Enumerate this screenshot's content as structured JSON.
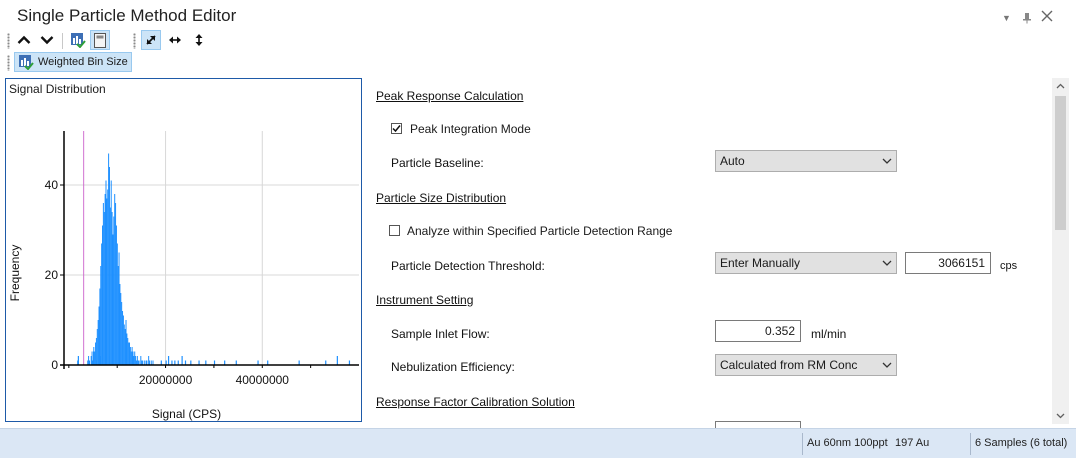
{
  "window": {
    "title": "Single Particle Method Editor",
    "controls": {
      "dropdown": "▼",
      "pin": "📌",
      "close": "✕"
    }
  },
  "toolbar1": {
    "up_icon": "chevron-up-icon",
    "down_icon": "chevron-down-icon",
    "tool3_icon": "chart-check-icon",
    "tool4_icon": "calculator-icon",
    "fit_icon": "diagonal-resize-icon",
    "horizontal_icon": "horizontal-resize-icon",
    "vertical_icon": "vertical-resize-icon"
  },
  "toolbar2": {
    "weighted_bin_label": "Weighted Bin Size"
  },
  "chart_panel": {
    "title": "Signal Distribution"
  },
  "chart_data": {
    "type": "bar",
    "title": "Signal Distribution",
    "xlabel": "Signal (CPS)",
    "ylabel": "Frequency",
    "xlim": [
      -1000000,
      60000000
    ],
    "ylim": [
      0,
      52
    ],
    "xticks": [
      20000000,
      40000000
    ],
    "xtick_labels": [
      "20000000",
      "40000000"
    ],
    "yticks": [
      0,
      20,
      40
    ],
    "ytick_labels": [
      "0",
      "20",
      "40"
    ],
    "grid": true,
    "threshold_line": 3066151,
    "bin_width": 180000,
    "bin_start": 3800000,
    "frequencies": [
      1,
      2,
      1,
      0,
      2,
      3,
      1,
      4,
      3,
      5,
      6,
      8,
      10,
      13,
      17,
      22,
      27,
      31,
      36,
      34,
      38,
      41,
      37,
      39,
      47,
      44,
      35,
      41,
      34,
      29,
      33,
      38,
      36,
      31,
      27,
      22,
      25,
      18,
      16,
      14,
      12,
      11,
      9,
      8,
      10,
      7,
      6,
      5,
      5,
      4,
      3,
      4,
      3,
      2,
      3,
      2,
      1,
      2,
      1,
      1,
      0,
      2,
      1,
      1,
      0,
      1,
      0,
      1,
      1,
      0,
      2,
      1,
      0,
      1,
      0,
      1
    ],
    "sparse_x": [
      1720000,
      1850000,
      4100000,
      5000000,
      5600000,
      6300000,
      7600000,
      8200000,
      19000000,
      20000000,
      20500000,
      21200000,
      21800000,
      22500000,
      23300000,
      24000000,
      25100000,
      26800000,
      28200000,
      30000000,
      32100000,
      34500000,
      39000000,
      41000000,
      47500000,
      53000000,
      55400000,
      57900000
    ],
    "sparse_y": [
      1,
      2,
      1,
      3,
      1,
      2,
      1,
      2,
      1,
      1,
      2,
      1,
      1,
      1,
      2,
      1,
      1,
      1,
      1,
      1,
      1,
      1,
      1,
      1,
      1,
      1,
      2,
      1
    ]
  },
  "form": {
    "peak_response_header": "Peak Response Calculation",
    "peak_integration_label": "Peak Integration Mode",
    "peak_integration_checked": true,
    "particle_baseline_label": "Particle Baseline:",
    "particle_baseline_value": "Auto",
    "particle_size_header": "Particle Size Distribution",
    "analyze_within_label": "Analyze within Specified Particle Detection Range",
    "analyze_within_checked": false,
    "detection_threshold_label": "Particle Detection Threshold:",
    "detection_threshold_mode": "Enter Manually",
    "detection_threshold_value": "3066151",
    "detection_threshold_unit": "cps",
    "instrument_header": "Instrument Setting",
    "sample_inlet_label": "Sample Inlet Flow:",
    "sample_inlet_value": "0.352",
    "sample_inlet_unit": "ml/min",
    "nebulization_label": "Nebulization Efficiency:",
    "nebulization_value": "Calculated from RM Conc",
    "response_factor_header": "Response Factor Calibration Solution"
  },
  "statusbar": {
    "sample": "Au 60nm 100ppt",
    "element": "197  Au",
    "samples": "6 Samples (6 total)"
  },
  "colors": {
    "bar": "#1e90ff",
    "threshold": "#d070d0",
    "accent": "#cce4f7"
  }
}
